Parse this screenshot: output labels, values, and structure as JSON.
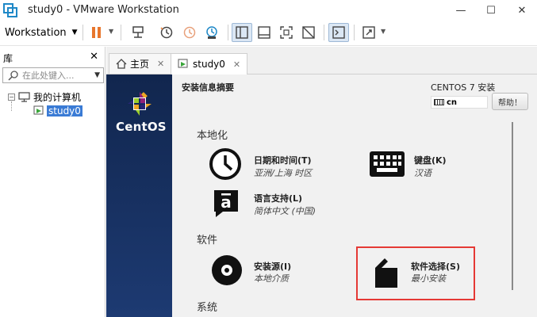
{
  "window": {
    "title": "study0 - VMware Workstation",
    "minimize": "—",
    "maximize": "☐",
    "close": "✕"
  },
  "toolbar": {
    "menu_label": "Workstation",
    "accent_color": "#e8762c"
  },
  "library": {
    "title": "库",
    "close": "✕",
    "search_placeholder": "在此处键入...",
    "tree": {
      "root_toggle": "⊟",
      "root_label": "我的计算机",
      "vm_label": "study0"
    }
  },
  "tabs": [
    {
      "label": "主页",
      "close": "✕",
      "icon": "home-icon"
    },
    {
      "label": "study0",
      "close": "✕",
      "icon": "vm-icon"
    }
  ],
  "installer": {
    "brand": "CentOS",
    "hub_title": "安装信息摘要",
    "version": "CENTOS 7 安装",
    "keyboard_layout": "cn",
    "help_button": "帮助！",
    "sections": [
      {
        "label": "本地化"
      },
      {
        "label": "软件"
      },
      {
        "label": "系统"
      }
    ],
    "spokes": {
      "datetime": {
        "title": "日期和时间(T)",
        "status": "亚洲/上海 时区",
        "icon": "clock-icon"
      },
      "keyboard": {
        "title": "键盘(K)",
        "status": "汉语",
        "icon": "keyboard-icon"
      },
      "language": {
        "title": "语言支持(L)",
        "status": "简体中文 (中国)",
        "icon": "language-icon"
      },
      "source": {
        "title": "安装源(I)",
        "status": "本地介质",
        "icon": "disc-icon"
      },
      "software": {
        "title": "软件选择(S)",
        "status": "最小安装",
        "icon": "package-icon"
      }
    },
    "highlight_color": "#e53935"
  }
}
